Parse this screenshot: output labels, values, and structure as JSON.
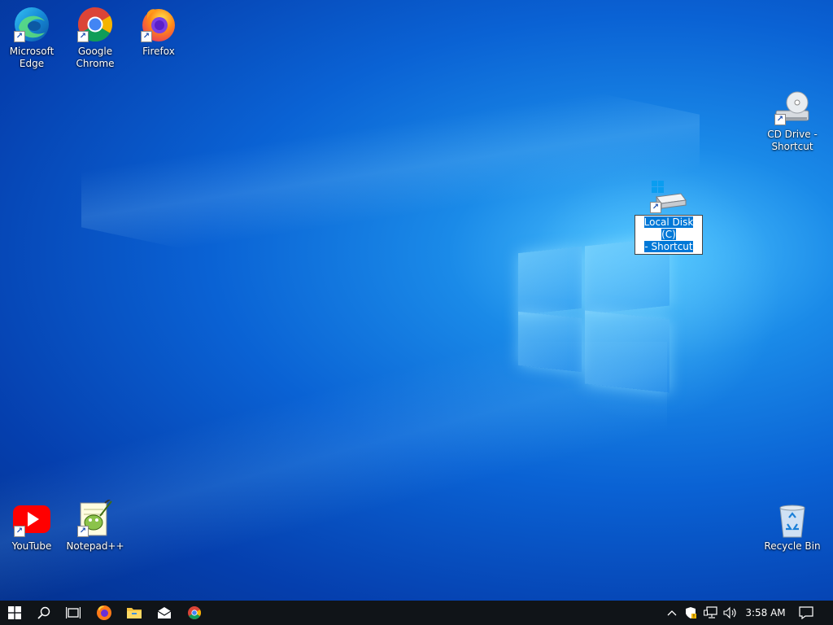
{
  "desktop": {
    "icons": {
      "edge": "Microsoft Edge",
      "chrome": "Google Chrome",
      "firefox": "Firefox",
      "cd_drive": "CD Drive - Shortcut",
      "local_disk_line1": "Local Disk (C)",
      "local_disk_line2": "- Shortcut",
      "youtube": "YouTube",
      "notepadpp": "Notepad++",
      "recycle_bin": "Recycle Bin"
    }
  },
  "taskbar": {
    "clock": "3:58 AM",
    "pinned": [
      "firefox-icon",
      "file-explorer-icon",
      "mail-icon",
      "chrome-icon"
    ]
  },
  "colors": {
    "taskbar_bg": "#101418",
    "selection": "#0078d7",
    "wallpaper_dark": "#04318f",
    "wallpaper_light": "#4cc2ff"
  }
}
